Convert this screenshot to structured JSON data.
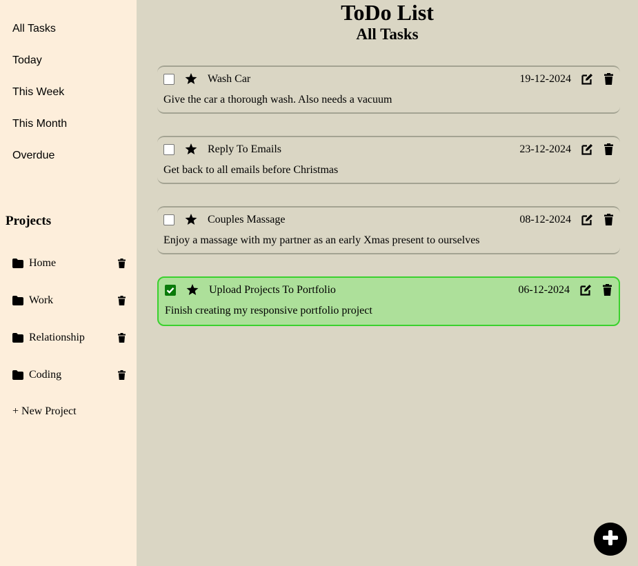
{
  "sidebar": {
    "nav": [
      {
        "label": "All Tasks"
      },
      {
        "label": "Today"
      },
      {
        "label": "This Week"
      },
      {
        "label": "This Month"
      },
      {
        "label": "Overdue"
      }
    ],
    "projects_heading": "Projects",
    "projects": [
      {
        "label": "Home"
      },
      {
        "label": "Work"
      },
      {
        "label": "Relationship"
      },
      {
        "label": "Coding"
      }
    ],
    "new_project_label": "+ New Project"
  },
  "main": {
    "app_title": "ToDo List",
    "view_title": "All Tasks",
    "tasks": [
      {
        "name": "Wash Car",
        "date": "19-12-2024",
        "description": "Give the car a thorough wash. Also needs a vacuum",
        "completed": false
      },
      {
        "name": "Reply To Emails",
        "date": "23-12-2024",
        "description": "Get back to all emails before Christmas",
        "completed": false
      },
      {
        "name": "Couples Massage",
        "date": "08-12-2024",
        "description": "Enjoy a massage with my partner as an early Xmas present to ourselves",
        "completed": false
      },
      {
        "name": "Upload Projects To Portfolio",
        "date": "06-12-2024",
        "description": "Finish creating my responsive portfolio project",
        "completed": true
      }
    ]
  },
  "icons": {
    "star": "star-icon",
    "edit": "edit-icon",
    "delete": "trash-icon",
    "folder": "folder-icon",
    "add": "plus-icon"
  },
  "colors": {
    "sidebar_bg": "#fdeedb",
    "main_bg": "#dad6c4",
    "completed_bg": "#ade09a",
    "completed_border": "#3ad12e"
  }
}
